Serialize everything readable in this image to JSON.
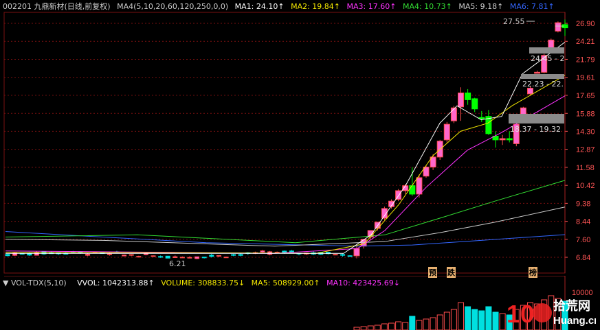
{
  "header": {
    "stock": "002201 九鼎新材(日线,前复权)",
    "items": [
      {
        "label": "MA4(5,10,20,60,120,250,0,0)",
        "color": "#cccccc"
      },
      {
        "label": "MA1: 24.10↑",
        "color": "#ffffff"
      },
      {
        "label": "MA2: 19.84↑",
        "color": "#f2e600"
      },
      {
        "label": "MA3: 17.60↑",
        "color": "#ff33ff"
      },
      {
        "label": "MA4: 10.73↑",
        "color": "#33dd33"
      },
      {
        "label": "MA5: 9.18↑",
        "color": "#cccccc"
      },
      {
        "label": "MA6: 7.81↑",
        "color": "#3366ff"
      }
    ]
  },
  "price_axis": {
    "ticks": [
      "26.90",
      "24.21",
      "21.79",
      "19.61",
      "17.65",
      "15.88",
      "14.30",
      "12.87",
      "11.58",
      "10.42",
      "9.38",
      "8.44",
      "7.60",
      "6.84"
    ]
  },
  "annotations": {
    "high": "27.55",
    "low": "6.21",
    "gaps": [
      {
        "label": "24.45 - 2"
      },
      {
        "label": "22.23 - 22."
      },
      {
        "label": "18.37 - 19.32"
      }
    ],
    "markers": [
      "预",
      "跌",
      "榜"
    ]
  },
  "volume_header": {
    "items": [
      {
        "label": "VOL-TDX(5,10)",
        "color": "#cccccc"
      },
      {
        "label": "VVOL: 1042313.88↑",
        "color": "#ffffff"
      },
      {
        "label": "VOLUME: 308833.75↓",
        "color": "#f2e600"
      },
      {
        "label": "MA5: 508929.00↑",
        "color": "#f2e600"
      },
      {
        "label": "MA10: 423425.69↓",
        "color": "#ff33ff"
      }
    ]
  },
  "volume_axis": {
    "ticks": [
      "10000"
    ]
  },
  "watermark": {
    "text1": "10",
    "text2": "拾荒网",
    "text3": "Huang.cn"
  },
  "colors": {
    "up": "#ff4d4d",
    "up_fill": "#ff66cc",
    "down": "#00e0e0",
    "down_fill": "#00ff00",
    "grid": "#7a1010"
  },
  "chart_data": {
    "type": "candlestick",
    "last_candles": [
      {
        "o": 6.9,
        "h": 7.3,
        "l": 6.8,
        "c": 7.2
      },
      {
        "o": 7.3,
        "h": 7.6,
        "l": 7.2,
        "c": 7.6
      },
      {
        "o": 7.7,
        "h": 8.0,
        "l": 7.6,
        "c": 8.0
      },
      {
        "o": 8.1,
        "h": 8.4,
        "l": 8.0,
        "c": 8.4
      },
      {
        "o": 8.6,
        "h": 9.2,
        "l": 8.5,
        "c": 9.1
      },
      {
        "o": 9.2,
        "h": 9.6,
        "l": 9.1,
        "c": 9.5
      },
      {
        "o": 9.6,
        "h": 10.2,
        "l": 9.5,
        "c": 10.1
      },
      {
        "o": 10.1,
        "h": 10.5,
        "l": 9.9,
        "c": 10.4
      },
      {
        "o": 10.4,
        "h": 11.6,
        "l": 9.8,
        "c": 9.9
      },
      {
        "o": 9.9,
        "h": 11.1,
        "l": 9.7,
        "c": 10.9
      },
      {
        "o": 11.0,
        "h": 11.7,
        "l": 10.9,
        "c": 11.6
      },
      {
        "o": 11.6,
        "h": 12.5,
        "l": 11.4,
        "c": 12.3
      },
      {
        "o": 12.3,
        "h": 13.6,
        "l": 12.1,
        "c": 13.5
      },
      {
        "o": 13.6,
        "h": 15.1,
        "l": 13.4,
        "c": 14.9
      },
      {
        "o": 15.2,
        "h": 16.6,
        "l": 15.0,
        "c": 16.4
      },
      {
        "o": 16.5,
        "h": 18.5,
        "l": 15.2,
        "c": 17.9
      },
      {
        "o": 17.9,
        "h": 18.3,
        "l": 16.7,
        "c": 17.2
      },
      {
        "o": 17.3,
        "h": 17.4,
        "l": 16.0,
        "c": 16.3
      },
      {
        "o": 15.5,
        "h": 16.1,
        "l": 15.1,
        "c": 15.4
      },
      {
        "o": 15.6,
        "h": 16.2,
        "l": 14.0,
        "c": 14.1
      },
      {
        "o": 13.9,
        "h": 14.3,
        "l": 13.0,
        "c": 13.6
      },
      {
        "o": 13.6,
        "h": 14.0,
        "l": 13.2,
        "c": 13.7
      },
      {
        "o": 13.7,
        "h": 14.3,
        "l": 13.4,
        "c": 13.6
      },
      {
        "o": 13.3,
        "h": 15.0,
        "l": 13.1,
        "c": 14.9
      },
      {
        "o": 15.8,
        "h": 16.5,
        "l": 15.7,
        "c": 16.4
      },
      {
        "o": 17.8,
        "h": 18.6,
        "l": 17.6,
        "c": 18.4
      },
      {
        "o": 20.2,
        "h": 20.4,
        "l": 20.1,
        "c": 20.2
      },
      {
        "o": 20.2,
        "h": 22.5,
        "l": 20.1,
        "c": 22.3
      },
      {
        "o": 22.8,
        "h": 24.6,
        "l": 22.6,
        "c": 24.4
      },
      {
        "o": 25.7,
        "h": 27.2,
        "l": 25.5,
        "c": 27.0
      },
      {
        "o": 26.7,
        "h": 27.5,
        "l": 25.0,
        "c": 26.2
      }
    ]
  }
}
